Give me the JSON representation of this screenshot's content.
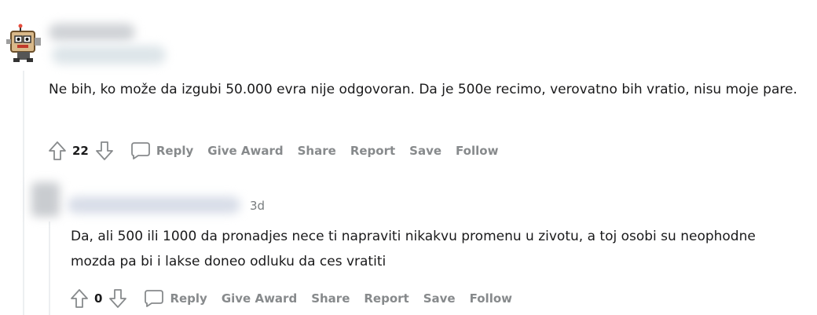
{
  "comments": [
    {
      "author": "",
      "body": "Ne bih, ko može da izgubi 50.000 evra nije odgovoran. Da je 500e recimo, verovatno bih vratio, nisu moje pare.",
      "votes": "22",
      "actions": {
        "reply": "Reply",
        "award": "Give Award",
        "share": "Share",
        "report": "Report",
        "save": "Save",
        "follow": "Follow"
      }
    },
    {
      "author": "",
      "time": "3d",
      "body": "Da, ali 500 ili 1000 da pronadjes nece ti napraviti nikakvu promenu u zivotu, a toj osobi su neophodne mozda pa bi i lakse doneo odluku da ces vratiti",
      "votes": "0",
      "actions": {
        "reply": "Reply",
        "award": "Give Award",
        "share": "Share",
        "report": "Report",
        "save": "Save",
        "follow": "Follow"
      }
    }
  ],
  "colors": {
    "icon": "#878a8c",
    "text": "#1a1a1b",
    "thread_line": "#edeff1",
    "time": "#787c7e"
  },
  "icons": [
    "upvote-icon",
    "downvote-icon",
    "comment-bubble-icon"
  ]
}
